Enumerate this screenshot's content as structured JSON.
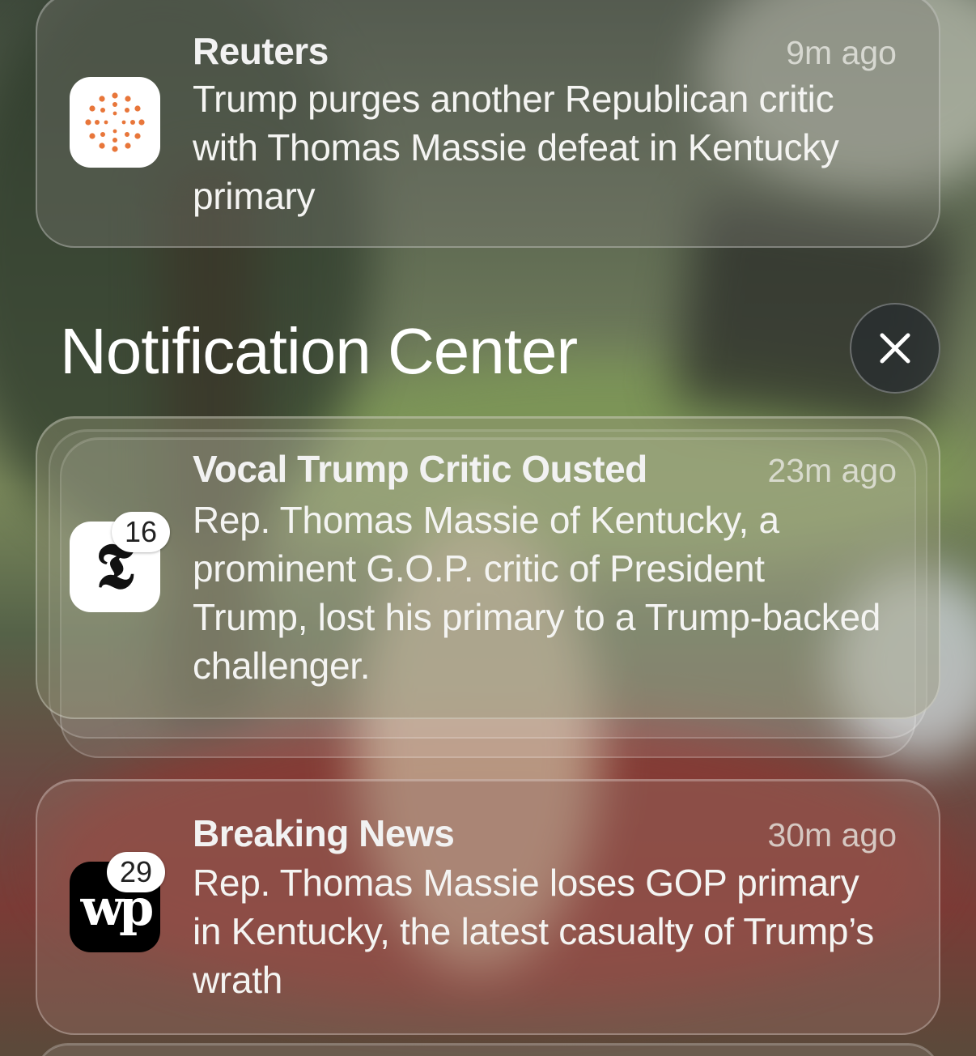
{
  "notification_center": {
    "title": "Notification Center",
    "close_icon": "close-icon"
  },
  "notifications": [
    {
      "app": "Reuters",
      "icon": "reuters-logo-icon",
      "title": "Reuters",
      "time": "9m ago",
      "body": "Trump purges another Republican critic with Thomas Massie defeat in Kentucky primary"
    },
    {
      "app": "The New York Times",
      "icon": "nyt-logo-icon",
      "badge": "16",
      "title": "Vocal Trump Critic Ousted",
      "time": "23m ago",
      "body": "Rep. Thomas Massie of Kentucky, a prominent G.O.P. critic of President Trump, lost his primary to a Trump-backed challenger."
    },
    {
      "app": "The Washington Post",
      "icon": "wp-logo-icon",
      "badge": "29",
      "title": "Breaking News",
      "time": "30m ago",
      "body": "Rep. Thomas Massie loses GOP primary in Kentucky, the latest casualty of Trump’s wrath"
    }
  ]
}
